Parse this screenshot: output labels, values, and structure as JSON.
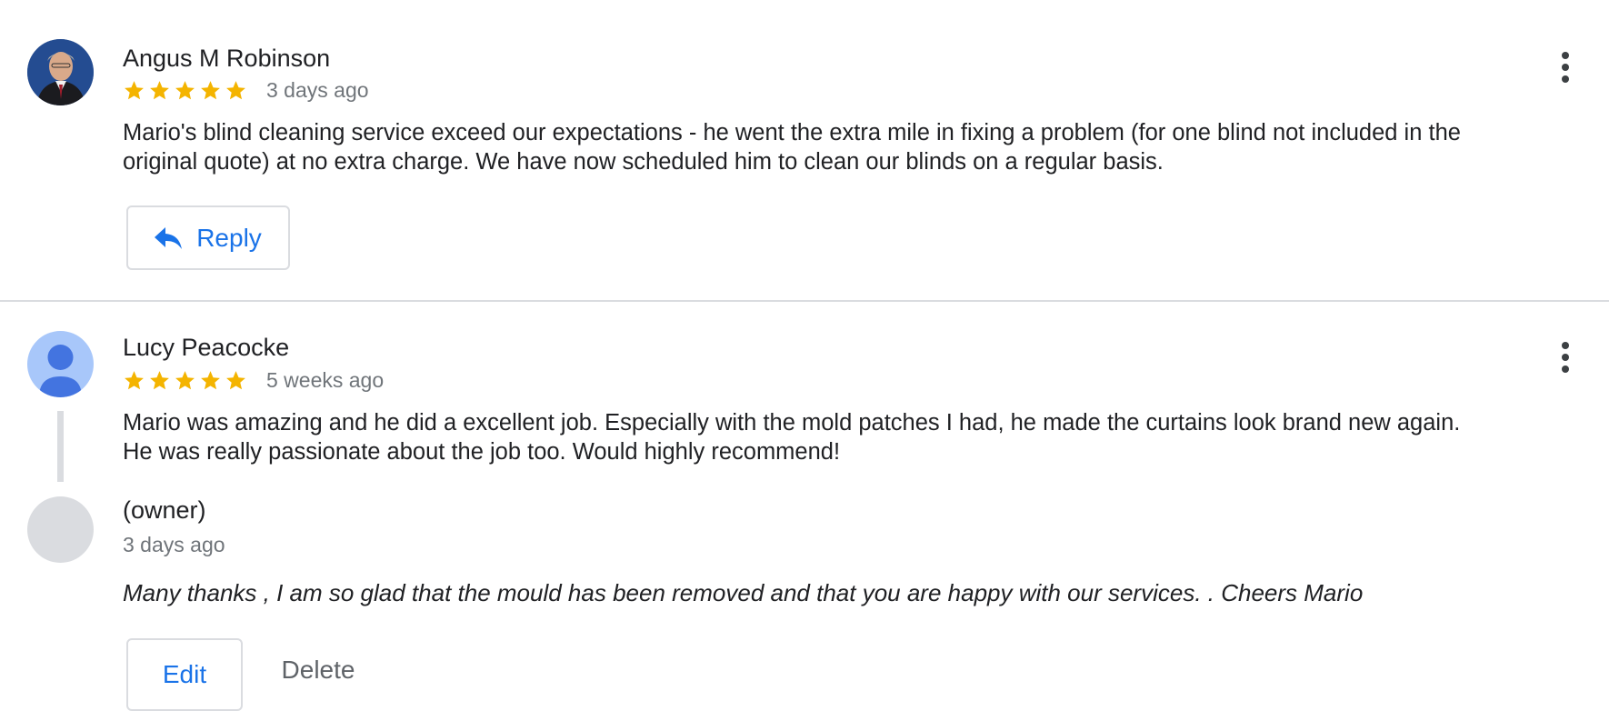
{
  "colors": {
    "star": "#f4b400",
    "accent": "#1a73e8",
    "text": "#202124",
    "muted": "#70757a",
    "divider": "#dadce0",
    "avatar_default_bg": "#a8c7fa",
    "avatar_default_fg": "#4374e0",
    "owner_avatar_bg": "#dadce0"
  },
  "reviews": [
    {
      "reviewer": "Angus M Robinson",
      "avatar": "photo-avatar",
      "rating": 5,
      "time": "3 days ago",
      "text": "Mario's blind cleaning service exceed our expectations - he went the extra mile in fixing a problem (for one blind not included in the original quote) at no extra charge. We have now scheduled him to clean our blinds on a regular basis.",
      "reply_label": "Reply",
      "menu_icon": "more-vert-icon"
    },
    {
      "reviewer": "Lucy Peacocke",
      "avatar": "default-person-avatar",
      "rating": 5,
      "time": "5 weeks ago",
      "text": "Mario was amazing and he did a excellent job. Especially with the mold patches I had, he made the curtains look brand new again. He was really passionate about the job too. Would highly recommend!",
      "menu_icon": "more-vert-icon",
      "owner_reply": {
        "name": "(owner)",
        "time": "3 days ago",
        "text": "Many thanks , I am so glad that the mould has been removed and that you are happy with our services. . Cheers Mario",
        "edit_label": "Edit",
        "delete_label": "Delete"
      }
    }
  ]
}
